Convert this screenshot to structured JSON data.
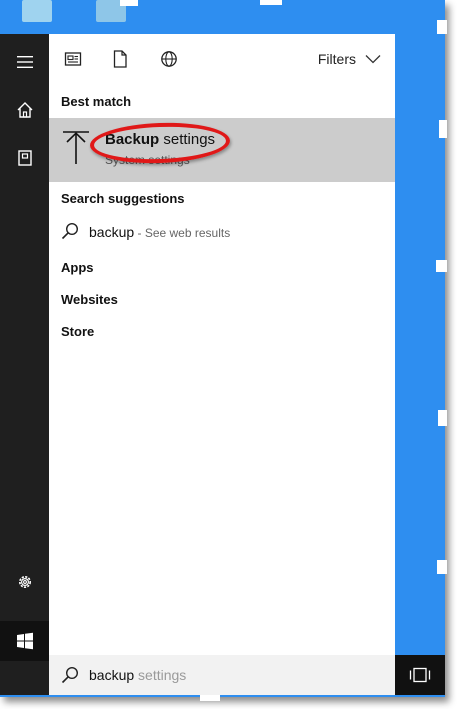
{
  "toolbar": {
    "filters_label": "Filters"
  },
  "best_match": {
    "heading": "Best match",
    "title_bold": "Backup",
    "title_rest": " settings",
    "subtitle": "System settings"
  },
  "suggestions": {
    "heading": "Search suggestions",
    "query": "backup",
    "hint": " - See web results"
  },
  "categories": {
    "apps": "Apps",
    "websites": "Websites",
    "store": "Store"
  },
  "searchbar": {
    "typed": "backup",
    "autocomplete": " settings"
  },
  "icons": {
    "rail": [
      "hamburger-icon",
      "home-icon",
      "notebook-icon",
      "settings-gear-icon",
      "feedback-icon"
    ],
    "start": "windows-logo-icon",
    "toolbar": [
      "documents-icon",
      "file-icon",
      "globe-icon"
    ],
    "task_view": "task-view-icon"
  },
  "colors": {
    "desktop": "#2e8ef0",
    "rail": "#1f1f1f",
    "selection": "#cccccc",
    "highlight_oval": "#e01818"
  }
}
